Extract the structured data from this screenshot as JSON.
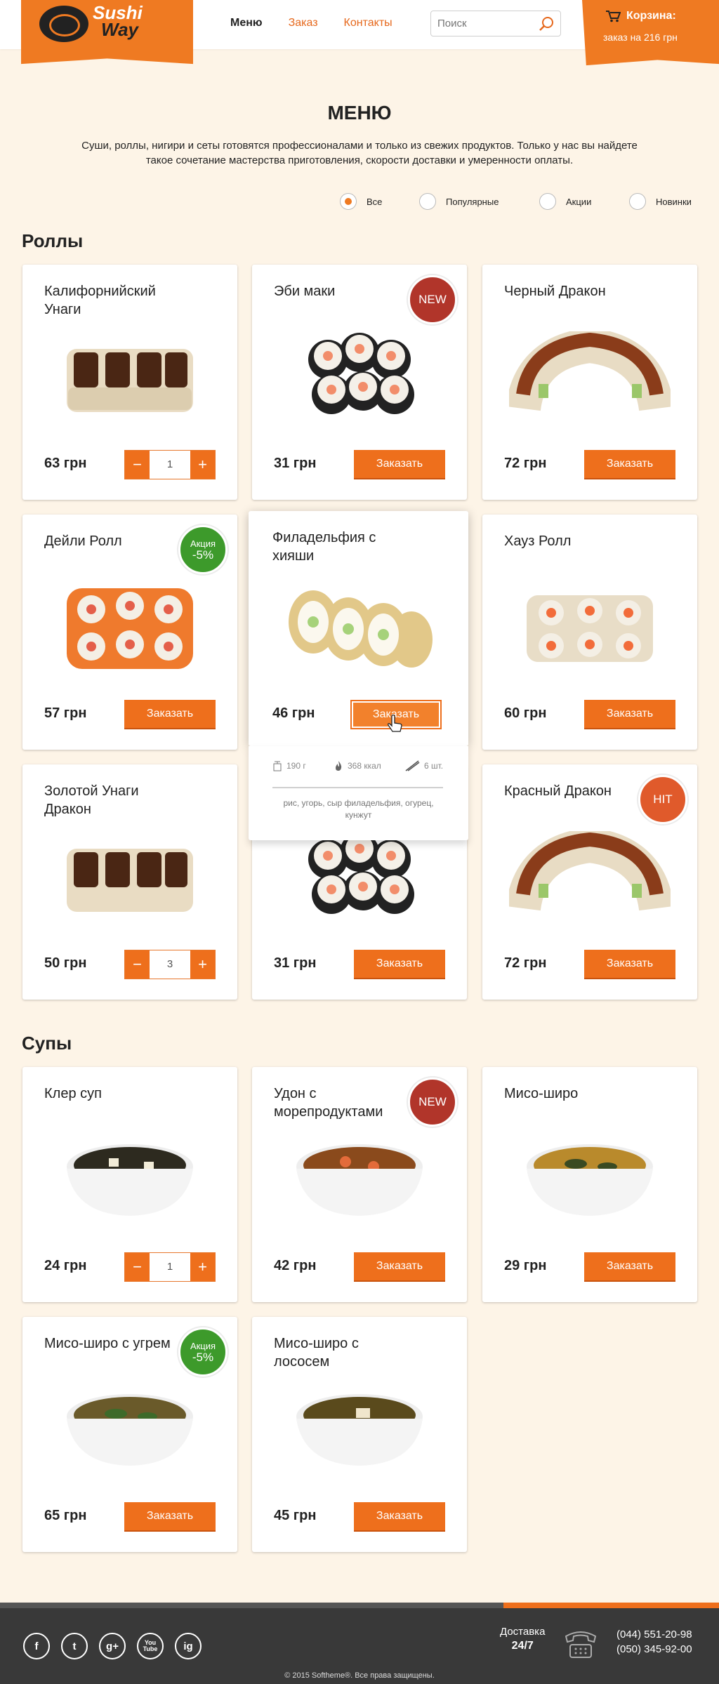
{
  "header": {
    "logo_line1": "Sushi",
    "logo_line2": "Way",
    "nav": [
      "Меню",
      "Заказ",
      "Контакты"
    ],
    "search_placeholder": "Поиск",
    "cart_title": "Корзина:",
    "cart_sum": "заказ на 216 грн"
  },
  "page": {
    "title": "МЕНЮ",
    "intro_line1": "Суши, роллы, нигири и сеты готовятся профессионалами и только из свежих продуктов. Только у нас вы найдете",
    "intro_line2": "такое сочетание мастерства приготовления, скорости доставки и умеренности оплаты."
  },
  "filters": [
    {
      "label": "Все",
      "selected": true
    },
    {
      "label": "Популярные",
      "selected": false
    },
    {
      "label": "Акции",
      "selected": false
    },
    {
      "label": "Новинки",
      "selected": false
    }
  ],
  "order_label": "Заказать",
  "sections": {
    "rolls": "Роллы",
    "soups": "Супы"
  },
  "rolls": [
    {
      "name": "Калифорнийский Унаги",
      "price": "63 грн",
      "qty": "1"
    },
    {
      "name": "Эби маки",
      "price": "31 грн",
      "badge": "NEW"
    },
    {
      "name": "Черный Дракон",
      "price": "72 грн"
    },
    {
      "name": "Дейли Ролл",
      "price": "57 грн",
      "badge_top": "Акция",
      "badge_bottom": "-5%"
    },
    {
      "name": "Филадельфия с хияши",
      "price": "46 грн",
      "weight": "190 г",
      "kcal": "368 ккал",
      "pieces": "6 шт.",
      "ingredients": "рис, угорь, сыр филадельфия, огурец, кунжут"
    },
    {
      "name": "Хауз Ролл",
      "price": "60 грн"
    },
    {
      "name": "Золотой Унаги Дракон",
      "price": "50 грн",
      "qty": "3"
    },
    {
      "name": "",
      "price": "31 грн"
    },
    {
      "name": "Красный Дракон",
      "price": "72 грн",
      "badge": "HIT"
    }
  ],
  "soups": [
    {
      "name": "Клер суп",
      "price": "24 грн",
      "qty": "1"
    },
    {
      "name": "Удон с морепродуктами",
      "price": "42 грн",
      "badge": "NEW"
    },
    {
      "name": "Мисо-широ",
      "price": "29 грн"
    },
    {
      "name": "Мисо-широ с угрем",
      "price": "65 грн",
      "badge_top": "Акция",
      "badge_bottom": "-5%"
    },
    {
      "name": "Мисо-широ с лососем",
      "price": "45 грн"
    }
  ],
  "footer": {
    "social": [
      "f",
      "t",
      "g+",
      "You Tube",
      "ig"
    ],
    "delivery_label": "Доставка",
    "delivery_hours": "24/7",
    "phone1": "(044) 551-20-98",
    "phone2": "(050) 345-92-00",
    "copyright": "© 2015 Softheme®. Все права защищены."
  },
  "colors": {
    "accent": "#ee6f1c",
    "background": "#fdf4e7",
    "badge_new": "#b1352a",
    "badge_sale": "#3d9a2b",
    "footer": "#393939"
  }
}
